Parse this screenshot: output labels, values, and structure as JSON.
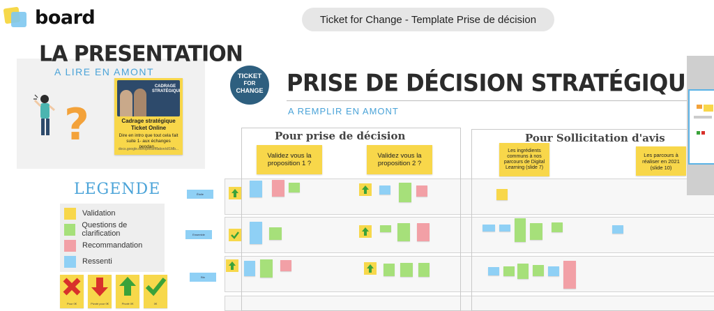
{
  "app": {
    "name": "board"
  },
  "board_title": "Ticket for Change - Template Prise de décision",
  "presentation": {
    "title": "LA PRESENTATION",
    "subtitle": "A LIRE EN AMONT",
    "card": {
      "image_text": "CADRAGE STRATÉGIQUE",
      "title": "Cadrage stratégique Ticket Online",
      "desc": "Dire en intro que tout cela fait suite 1- aux échanges pendan...",
      "link": "docs.google.com/presentation/d/1Mb..."
    }
  },
  "legend": {
    "title": "LEGENDE",
    "items": [
      {
        "label": "Validation",
        "color": "#f8d74a"
      },
      {
        "label": "Questions de clarification",
        "color": "#a6e07a"
      },
      {
        "label": "Recommandation",
        "color": "#f2a0a6"
      },
      {
        "label": "Ressenti",
        "color": "#8fd0f5"
      }
    ],
    "votes": [
      {
        "label": "Pour 0€",
        "icon": "red-x-icon"
      },
      {
        "label": "Pivoté pour 0€",
        "icon": "red-down-arrow-icon"
      },
      {
        "label": "Pivoté 0€",
        "icon": "green-up-arrow-icon"
      },
      {
        "label": "0€",
        "icon": "green-check-icon"
      }
    ],
    "side_tags": [
      "Étoile",
      "Ensemble",
      "Bio"
    ]
  },
  "badge": {
    "line1": "TICKET",
    "line2": "FOR",
    "line3": "CHANGE"
  },
  "main": {
    "title": "PRISE DE DÉCISION STRATÉGIQUE",
    "subtitle": "A REMPLIR EN AMONT",
    "frames": [
      {
        "title": "Pour prise de décision",
        "notes": [
          "Validez vous la proposition 1 ?",
          "Validez vous la proposition 2 ?"
        ]
      },
      {
        "title": "Pour Sollicitation d'avis",
        "notes": [
          "Les ingrédients communs à nos parcours de Digital Learning (slide 7)",
          "Les parcours à réaliser en 2021 (slide 10)"
        ]
      }
    ]
  },
  "colors": {
    "yellow": "#f8d74a",
    "green": "#a6e07a",
    "pink": "#f2a0a6",
    "blue": "#8fd0f5",
    "accent": "#4aa3d8",
    "badge": "#2e5f7f"
  }
}
